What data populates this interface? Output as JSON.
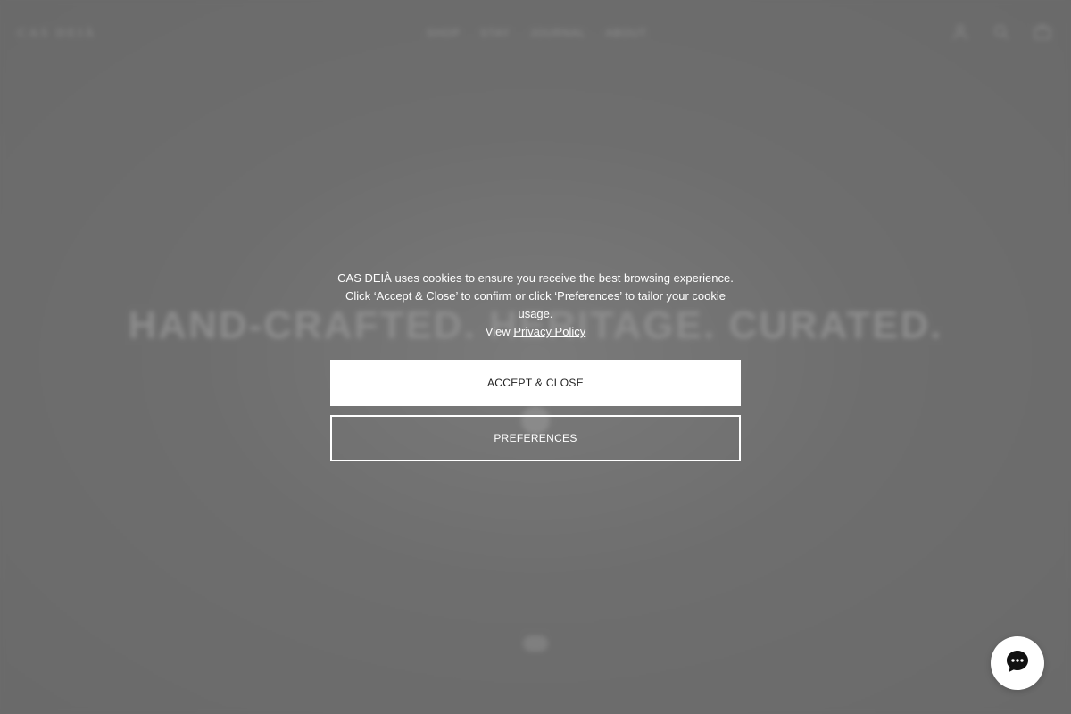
{
  "colors": {
    "overlay": "#6b6b6b",
    "button_primary_bg": "#ffffff",
    "button_primary_text": "#222222",
    "text_on_overlay": "#ffffff",
    "chat_icon": "#111111"
  },
  "header": {
    "logo": "CAS DEIÀ",
    "nav": [
      "SHOP",
      "STAY",
      "JOURNAL",
      "ABOUT"
    ],
    "icons": [
      "account-icon",
      "search-icon",
      "bag-icon"
    ]
  },
  "hero": {
    "title": "HAND-CRAFTED. HERITAGE. CURATED."
  },
  "cookie": {
    "line1": "CAS DEIÀ uses cookies to ensure you receive the best browsing experience.",
    "line2": "Click ‘Accept & Close’ to confirm or click ‘Preferences’ to tailor your cookie usage.",
    "line3_prefix": "View",
    "privacy_link": "Privacy Policy",
    "accept_label": "ACCEPT & CLOSE",
    "preferences_label": "PREFERENCES"
  },
  "chat": {
    "icon": "chat-bubble-icon"
  }
}
